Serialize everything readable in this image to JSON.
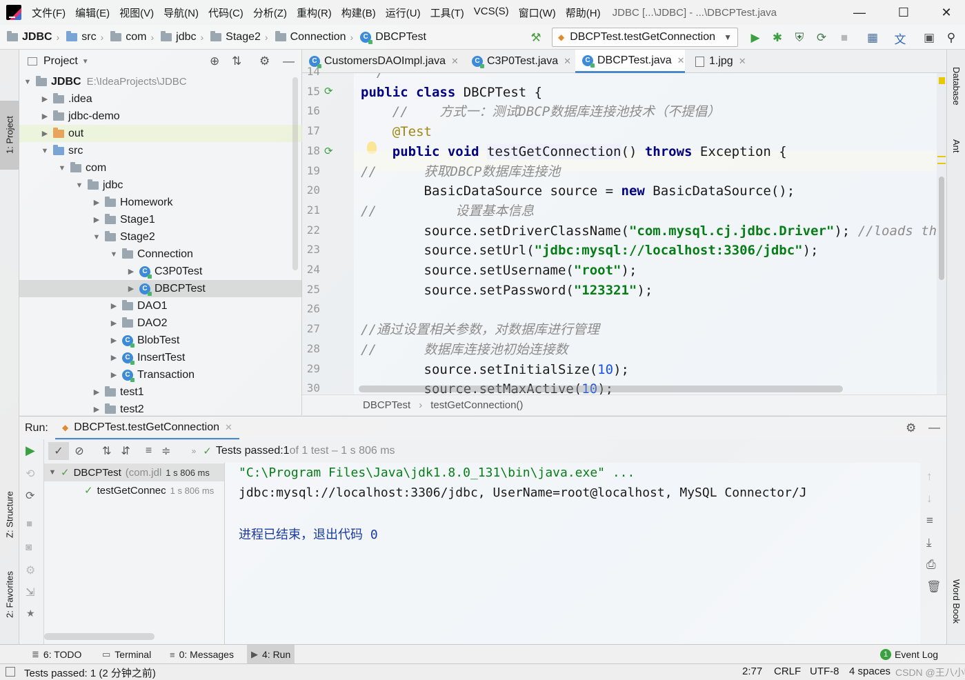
{
  "menu": {
    "items": [
      "文件(F)",
      "编辑(E)",
      "视图(V)",
      "导航(N)",
      "代码(C)",
      "分析(Z)",
      "重构(R)",
      "构建(B)",
      "运行(U)",
      "工具(T)",
      "VCS(S)",
      "窗口(W)",
      "帮助(H)"
    ],
    "window_title": "JDBC [...\\JDBC] - ...\\DBCPTest.java"
  },
  "window_controls": {
    "minimize": "—",
    "maximize": "☐",
    "close": "✕"
  },
  "breadcrumb": [
    "JDBC",
    "src",
    "com",
    "jdbc",
    "Stage2",
    "Connection",
    "DBCPTest"
  ],
  "run_config": {
    "label": "DBCPTest.testGetConnection"
  },
  "project": {
    "title": "Project",
    "tree": [
      {
        "label": "JDBC",
        "path": "E:\\IdeaProjects\\JDBC",
        "depth": 0,
        "arrow": "open",
        "icon": "folder"
      },
      {
        "label": ".idea",
        "depth": 1,
        "arrow": "closed",
        "icon": "folder"
      },
      {
        "label": "jdbc-demo",
        "depth": 1,
        "arrow": "closed",
        "icon": "folder"
      },
      {
        "label": "out",
        "depth": 1,
        "arrow": "closed",
        "icon": "folder-orange"
      },
      {
        "label": "src",
        "depth": 1,
        "arrow": "open",
        "icon": "folder-blue"
      },
      {
        "label": "com",
        "depth": 2,
        "arrow": "open",
        "icon": "folder"
      },
      {
        "label": "jdbc",
        "depth": 3,
        "arrow": "open",
        "icon": "folder"
      },
      {
        "label": "Homework",
        "depth": 4,
        "arrow": "closed",
        "icon": "folder"
      },
      {
        "label": "Stage1",
        "depth": 4,
        "arrow": "closed",
        "icon": "folder"
      },
      {
        "label": "Stage2",
        "depth": 4,
        "arrow": "open",
        "icon": "folder"
      },
      {
        "label": "Connection",
        "depth": 5,
        "arrow": "open",
        "icon": "folder"
      },
      {
        "label": "C3P0Test",
        "depth": 6,
        "arrow": "closed",
        "icon": "class"
      },
      {
        "label": "DBCPTest",
        "depth": 6,
        "arrow": "closed",
        "icon": "class"
      },
      {
        "label": "DAO1",
        "depth": 5,
        "arrow": "closed",
        "icon": "folder"
      },
      {
        "label": "DAO2",
        "depth": 5,
        "arrow": "closed",
        "icon": "folder"
      },
      {
        "label": "BlobTest",
        "depth": 5,
        "arrow": "closed",
        "icon": "class"
      },
      {
        "label": "InsertTest",
        "depth": 5,
        "arrow": "closed",
        "icon": "class"
      },
      {
        "label": "Transaction",
        "depth": 5,
        "arrow": "closed",
        "icon": "class"
      },
      {
        "label": "test1",
        "depth": 4,
        "arrow": "closed",
        "icon": "folder"
      },
      {
        "label": "test2",
        "depth": 4,
        "arrow": "closed",
        "icon": "folder"
      }
    ]
  },
  "editor": {
    "tabs": [
      {
        "label": "CustomersDAOImpl.java",
        "icon": "class"
      },
      {
        "label": "C3P0Test.java",
        "icon": "class"
      },
      {
        "label": "DBCPTest.java",
        "icon": "class",
        "active": true
      },
      {
        "label": "1.jpg",
        "icon": "image"
      }
    ],
    "line_numbers": [
      "14",
      "15",
      "16",
      "17",
      "18",
      "19",
      "20",
      "21",
      "22",
      "23",
      "24",
      "25",
      "26",
      "27",
      "28",
      "29",
      "30"
    ],
    "lines": [
      [
        {
          "t": " */",
          "c": "cmt"
        }
      ],
      [
        {
          "t": "public class ",
          "c": "kw"
        },
        {
          "t": "DBCPTest {",
          "c": ""
        }
      ],
      [
        {
          "t": "    //    方式一：测试DBCP数据库连接池技术（不提倡）",
          "c": "cmt"
        }
      ],
      [
        {
          "t": "    @Test",
          "c": "ann"
        }
      ],
      [
        {
          "t": "    public void ",
          "c": "kw"
        },
        {
          "t": "testGetConnection",
          "c": "hl"
        },
        {
          "t": "() ",
          "c": ""
        },
        {
          "t": "throws ",
          "c": "kw"
        },
        {
          "t": "Exception {",
          "c": ""
        }
      ],
      [
        {
          "t": "//      获取DBCP数据库连接池",
          "c": "cmt"
        }
      ],
      [
        {
          "t": "        BasicDataSource source = ",
          "c": ""
        },
        {
          "t": "new ",
          "c": "kw"
        },
        {
          "t": "BasicDataSource();",
          "c": ""
        }
      ],
      [
        {
          "t": "//          设置基本信息",
          "c": "cmt"
        }
      ],
      [
        {
          "t": "        source.setDriverClassName(",
          "c": ""
        },
        {
          "t": "\"com.mysql.cj.jdbc.Driver\"",
          "c": "str"
        },
        {
          "t": "); ",
          "c": ""
        },
        {
          "t": "//loads the jd",
          "c": "cmt"
        }
      ],
      [
        {
          "t": "        source.setUrl(",
          "c": ""
        },
        {
          "t": "\"jdbc:mysql://localhost:3306/jdbc\"",
          "c": "str"
        },
        {
          "t": ");",
          "c": ""
        }
      ],
      [
        {
          "t": "        source.setUsername(",
          "c": ""
        },
        {
          "t": "\"root\"",
          "c": "str"
        },
        {
          "t": ");",
          "c": ""
        }
      ],
      [
        {
          "t": "        source.setPassword(",
          "c": ""
        },
        {
          "t": "\"123321\"",
          "c": "str"
        },
        {
          "t": ");",
          "c": ""
        }
      ],
      [
        {
          "t": "",
          "c": ""
        }
      ],
      [
        {
          "t": "//通过设置相关参数，对数据库进行管理",
          "c": "cmt"
        }
      ],
      [
        {
          "t": "//      数据库连接池初始连接数",
          "c": "cmt"
        }
      ],
      [
        {
          "t": "        source.setInitialSize(",
          "c": ""
        },
        {
          "t": "10",
          "c": "num"
        },
        {
          "t": ");",
          "c": ""
        }
      ],
      [
        {
          "t": "        source.setMaxActive(",
          "c": ""
        },
        {
          "t": "10",
          "c": "num"
        },
        {
          "t": ");",
          "c": ""
        }
      ]
    ],
    "breadcrumb": [
      "DBCPTest",
      "testGetConnection()"
    ]
  },
  "run": {
    "label": "Run:",
    "tab": "DBCPTest.testGetConnection",
    "status_prefix": "Tests passed: ",
    "status_count": "1",
    "status_suffix": " of 1 test – 1 s 806 ms",
    "tests": [
      {
        "name": "DBCPTest",
        "detail": "(com.jdl",
        "time": "1 s 806 ms"
      },
      {
        "name": "testGetConnec",
        "time": "1 s 806 ms"
      }
    ],
    "console": [
      {
        "text": "\"C:\\Program Files\\Java\\jdk1.8.0_131\\bin\\java.exe\" ...",
        "c": "path"
      },
      {
        "text": "jdbc:mysql://localhost:3306/jdbc, UserName=root@localhost, MySQL Connector/J",
        "c": "out"
      },
      {
        "text": "",
        "c": "out"
      },
      {
        "text": "进程已结束，退出代码 0",
        "c": "exit"
      }
    ]
  },
  "bottom_tabs": [
    {
      "label": "6: TODO",
      "icon": "list-icon"
    },
    {
      "label": "Terminal",
      "icon": "terminal-icon"
    },
    {
      "label": "0: Messages",
      "icon": "messages-icon"
    },
    {
      "label": "4: Run",
      "icon": "run-icon",
      "active": true
    }
  ],
  "event_log": {
    "badge": "1",
    "label": "Event Log"
  },
  "side_tabs": {
    "project": "1: Project",
    "structure": "Z: Structure",
    "favorites": "2: Favorites",
    "database": "Database",
    "ant": "Ant",
    "wordbook": "Word Book"
  },
  "status": {
    "message": "Tests passed: 1 (2 分钟之前)",
    "position": "2:77",
    "line_sep": "CRLF",
    "encoding": "UTF-8",
    "indent": "4 spaces",
    "watermark": "CSDN @王八小鸭"
  },
  "colors": {
    "keyword": "#000080",
    "string": "#067d17",
    "number": "#1750eb",
    "comment": "#8c8c8c",
    "annotation": "#9e880d",
    "pass": "#4da043",
    "accent": "#4a88c7"
  }
}
